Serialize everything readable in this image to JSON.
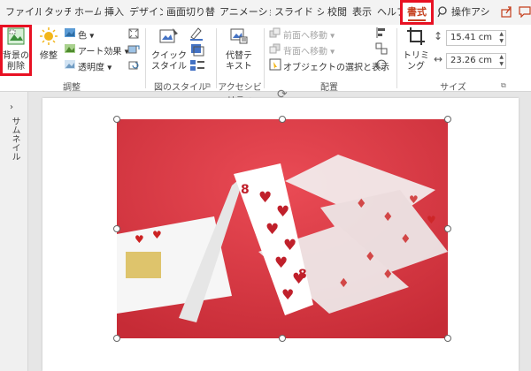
{
  "tabs": [
    {
      "label": "ファイル"
    },
    {
      "label": "タッチ"
    },
    {
      "label": "ホーム"
    },
    {
      "label": "挿入"
    },
    {
      "label": "デザイン"
    },
    {
      "label": "画面切り替え"
    },
    {
      "label": "アニメーション"
    },
    {
      "label": "スライド ショー"
    },
    {
      "label": "校閲"
    },
    {
      "label": "表示"
    },
    {
      "label": "ヘルプ"
    },
    {
      "label": "書式"
    },
    {
      "label": "操作アシ"
    }
  ],
  "ribbon": {
    "remove_background": "背景の削除",
    "corrections": "修整",
    "color": "色",
    "artistic_effects": "アート効果",
    "transparency": "透明度",
    "group_adjust": "調整",
    "quick_styles": "クイック スタイル",
    "group_picture_styles": "図のスタイル",
    "alt_text": "代替テ キスト",
    "group_accessibility": "アクセシビリティ",
    "bring_forward": "前面へ移動",
    "send_backward": "背面へ移動",
    "selection_pane": "オブジェクトの選択と表示",
    "group_arrange": "配置",
    "crop": "トリミング",
    "height_value": "15.41 cm",
    "width_value": "23.26 cm",
    "group_size": "サイズ"
  },
  "thumbs": {
    "label": "サムネイル"
  },
  "colors": {
    "highlight": "#e81123",
    "accent": "#c43e1c",
    "card_bg": "#d8343d"
  }
}
